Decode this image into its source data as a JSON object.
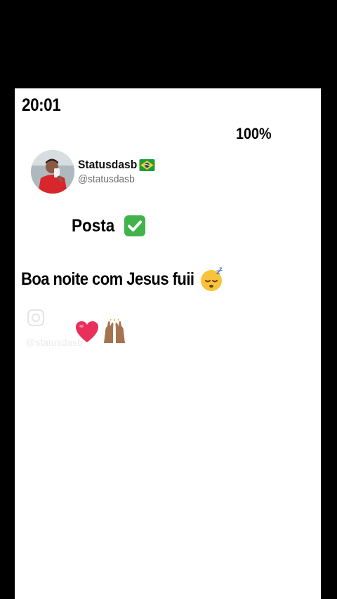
{
  "status_bar": {
    "time": "20:01",
    "battery": "100%"
  },
  "account": {
    "name": "Statusdasb",
    "handle": "@statusdasb",
    "flag_icon": "brazil-flag-icon"
  },
  "post": {
    "label": "Posta",
    "label_icon": "check-mark-button-icon",
    "message": "Boa noite com Jesus fuii",
    "message_icon": "sleeping-face-icon",
    "emojis": [
      "heart-icon",
      "raised-hands-icon"
    ]
  },
  "watermark": {
    "text": "@statusdasb"
  },
  "colors": {
    "background": "#000000",
    "card": "#ffffff",
    "text": "#000000",
    "handle": "#6e6e6e",
    "check_green": "#42b34a",
    "heart": "#e8305a"
  }
}
